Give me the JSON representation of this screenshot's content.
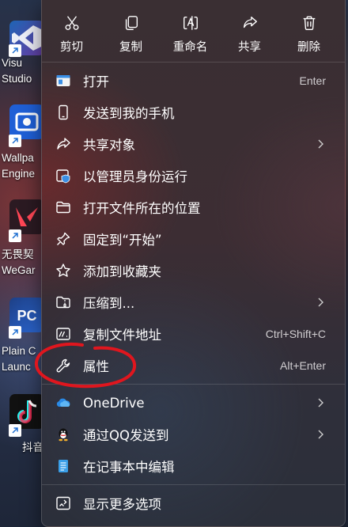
{
  "desktop": {
    "icons": [
      {
        "label_lines": [
          "Visu",
          "Studio"
        ],
        "icon": "visual-studio-icon"
      },
      {
        "label_lines": [
          "Wallpa",
          "Engine"
        ],
        "icon": "wallpaper-engine-icon"
      },
      {
        "label_lines": [
          "无畏契",
          "WeGar"
        ],
        "icon": "wegame-icon"
      },
      {
        "label_lines": [
          "Plain C",
          "Launc"
        ],
        "icon": "plain-craft-launcher-icon"
      },
      {
        "label_lines": [
          "抖音"
        ],
        "icon": "douyin-icon"
      }
    ]
  },
  "menu": {
    "toolbar": [
      {
        "label": "剪切",
        "icon": "scissors-icon"
      },
      {
        "label": "复制",
        "icon": "copy-icon"
      },
      {
        "label": "重命名",
        "icon": "rename-icon"
      },
      {
        "label": "共享",
        "icon": "share-icon"
      },
      {
        "label": "删除",
        "icon": "trash-icon"
      }
    ],
    "items": [
      {
        "label": "打开",
        "shortcut": "Enter",
        "icon": "open-app-icon"
      },
      {
        "label": "发送到我的手机",
        "icon": "phone-icon"
      },
      {
        "label": "共享对象",
        "submenu": true,
        "icon": "share-icon"
      },
      {
        "label": "以管理员身份运行",
        "icon": "admin-shield-icon"
      },
      {
        "label": "打开文件所在的位置",
        "icon": "folder-icon"
      },
      {
        "label": "固定到“开始”",
        "icon": "pin-icon"
      },
      {
        "label": "添加到收藏夹",
        "icon": "star-icon"
      },
      {
        "label": "压缩到...",
        "submenu": true,
        "icon": "zip-folder-icon"
      },
      {
        "label": "复制文件地址",
        "shortcut": "Ctrl+Shift+C",
        "icon": "copy-path-icon"
      },
      {
        "label": "属性",
        "shortcut": "Alt+Enter",
        "icon": "wrench-icon"
      },
      {
        "label": "OneDrive",
        "submenu": true,
        "icon": "onedrive-icon"
      },
      {
        "label": "通过QQ发送到",
        "submenu": true,
        "icon": "qq-icon"
      },
      {
        "label": "在记事本中编辑",
        "icon": "notepad-icon"
      },
      {
        "label": "显示更多选项",
        "icon": "more-options-icon"
      }
    ]
  },
  "colors": {
    "accent": "#60cdff",
    "annotation": "#e0161e"
  }
}
